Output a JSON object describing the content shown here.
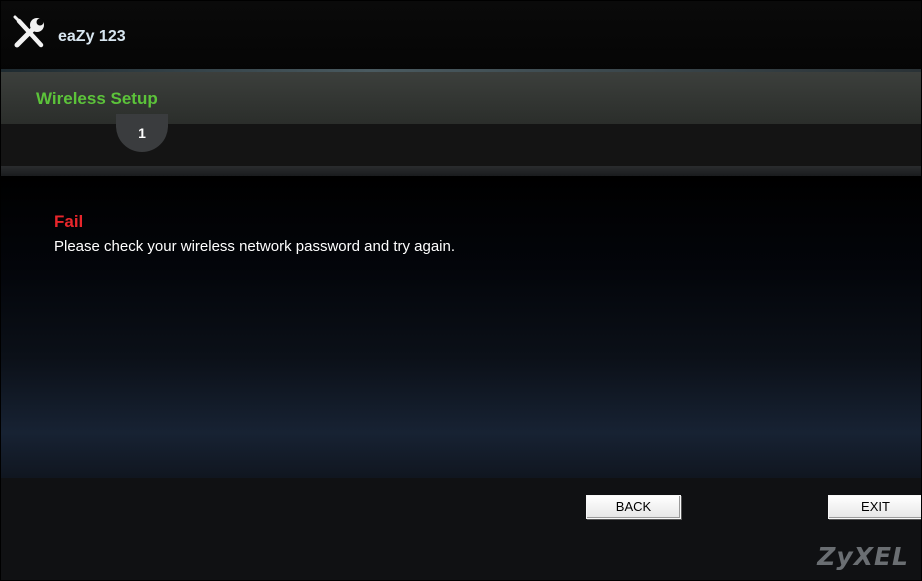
{
  "header": {
    "app_title": "eaZy 123",
    "logo_icon": "tools-icon"
  },
  "section": {
    "title": "Wireless Setup"
  },
  "steps": {
    "current": "1"
  },
  "message": {
    "title": "Fail",
    "body": "Please check your wireless network password and try again."
  },
  "buttons": {
    "back_label": "BACK",
    "exit_label": "EXIT"
  },
  "brand": {
    "logo_text": "ZyXEL"
  },
  "colors": {
    "section_title": "#5cc33a",
    "fail": "#e8262b",
    "background": "#000000"
  }
}
